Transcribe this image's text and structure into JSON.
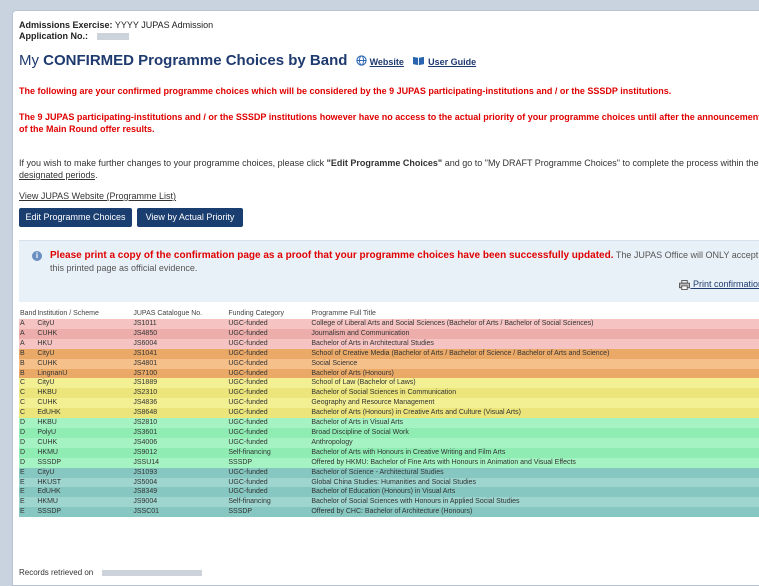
{
  "meta": {
    "exercise_label": "Admissions Exercise:",
    "exercise_value": "YYYY JUPAS Admission",
    "app_label": "Application No.:"
  },
  "header": {
    "title_prefix": "My ",
    "title_bold": "CONFIRMED",
    "title_suffix": " Programme Choices by Band",
    "website_link": "Website",
    "guide_link": "User Guide"
  },
  "notices": {
    "red1": "The following are your confirmed programme choices which will be considered by the 9 JUPAS participating-institutions and / or the SSSDP institutions.",
    "red2": "The 9 JUPAS participating-institutions and / or the SSSDP institutions however have no access to the actual priority of your programme choices until after the announcement of the Main Round offer results.",
    "info_pre": "If you wish to make further changes to your programme choices, please click ",
    "info_bold": "\"Edit Programme Choices\"",
    "info_mid": " and go to \"My DRAFT Programme Choices\" to complete the process within the ",
    "info_link": "designated periods",
    "info_end": "."
  },
  "links": {
    "programme_list": "View JUPAS Website (Programme List)"
  },
  "buttons": {
    "edit": "Edit Programme Choices",
    "view_priority": "View by Actual Priority"
  },
  "alert": {
    "emph": "Please print a copy of the confirmation page as a proof that your programme choices have been successfully updated.",
    "rest": " The JUPAS Office will ONLY accept this printed page as official evidence.",
    "print": "Print confirmation"
  },
  "table": {
    "headers": [
      "Band",
      "Institution / Scheme",
      "JUPAS Catalogue No.",
      "Funding Category",
      "Programme Full Title"
    ],
    "rows": [
      [
        "A",
        "CityU",
        "JS1011",
        "UGC-funded",
        "College of Liberal Arts and Social Sciences (Bachelor of Arts / Bachelor of Social Sciences)"
      ],
      [
        "A",
        "CUHK",
        "JS4850",
        "UGC-funded",
        "Journalism and Communication"
      ],
      [
        "A",
        "HKU",
        "JS6004",
        "UGC-funded",
        "Bachelor of Arts in Architectural Studies"
      ],
      [
        "B",
        "CityU",
        "JS1041",
        "UGC-funded",
        "School of Creative Media (Bachelor of Arts / Bachelor of Science / Bachelor of Arts and Science)"
      ],
      [
        "B",
        "CUHK",
        "JS4801",
        "UGC-funded",
        "Social Science"
      ],
      [
        "B",
        "LingnanU",
        "JS7100",
        "UGC-funded",
        "Bachelor of Arts (Honours)"
      ],
      [
        "C",
        "CityU",
        "JS1889",
        "UGC-funded",
        "School of Law (Bachelor of Laws)"
      ],
      [
        "C",
        "HKBU",
        "JS2310",
        "UGC-funded",
        "Bachelor of Social Sciences in Communication"
      ],
      [
        "C",
        "CUHK",
        "JS4836",
        "UGC-funded",
        "Geography and Resource Management"
      ],
      [
        "C",
        "EdUHK",
        "JS8648",
        "UGC-funded",
        "Bachelor of Arts (Honours) in Creative Arts and Culture (Visual Arts)"
      ],
      [
        "D",
        "HKBU",
        "JS2810",
        "UGC-funded",
        "Bachelor of Arts in Visual Arts"
      ],
      [
        "D",
        "PolyU",
        "JS3601",
        "UGC-funded",
        "Broad Discipline of Social Work"
      ],
      [
        "D",
        "CUHK",
        "JS4006",
        "UGC-funded",
        "Anthropology"
      ],
      [
        "D",
        "HKMU",
        "JS9012",
        "Self-financing",
        "Bachelor of Arts with Honours in Creative Writing and Film Arts"
      ],
      [
        "D",
        "SSSDP",
        "JSSU14",
        "SSSDP",
        "Offered by HKMU: Bachelor of Fine Arts with Honours in Animation and Visual Effects"
      ],
      [
        "E",
        "CityU",
        "JS1093",
        "UGC-funded",
        "Bachelor of Science - Architectural Studies"
      ],
      [
        "E",
        "HKUST",
        "JS5004",
        "UGC-funded",
        "Global China Studies: Humanities and Social Studies"
      ],
      [
        "E",
        "EdUHK",
        "JS8349",
        "UGC-funded",
        "Bachelor of Education (Honours) in Visual Arts"
      ],
      [
        "E",
        "HKMU",
        "JS9004",
        "Self-financing",
        "Bachelor of Social Sciences with Honours in Applied Social Studies"
      ],
      [
        "E",
        "SSSDP",
        "JSSC01",
        "SSSDP",
        "Offered by CHC: Bachelor of Architecture (Honours)"
      ]
    ]
  },
  "footer": {
    "retrieved": "Records retrieved on"
  },
  "icons": {
    "globe": "globe-icon",
    "book": "book-icon",
    "info": "info-icon",
    "printer": "printer-icon"
  }
}
